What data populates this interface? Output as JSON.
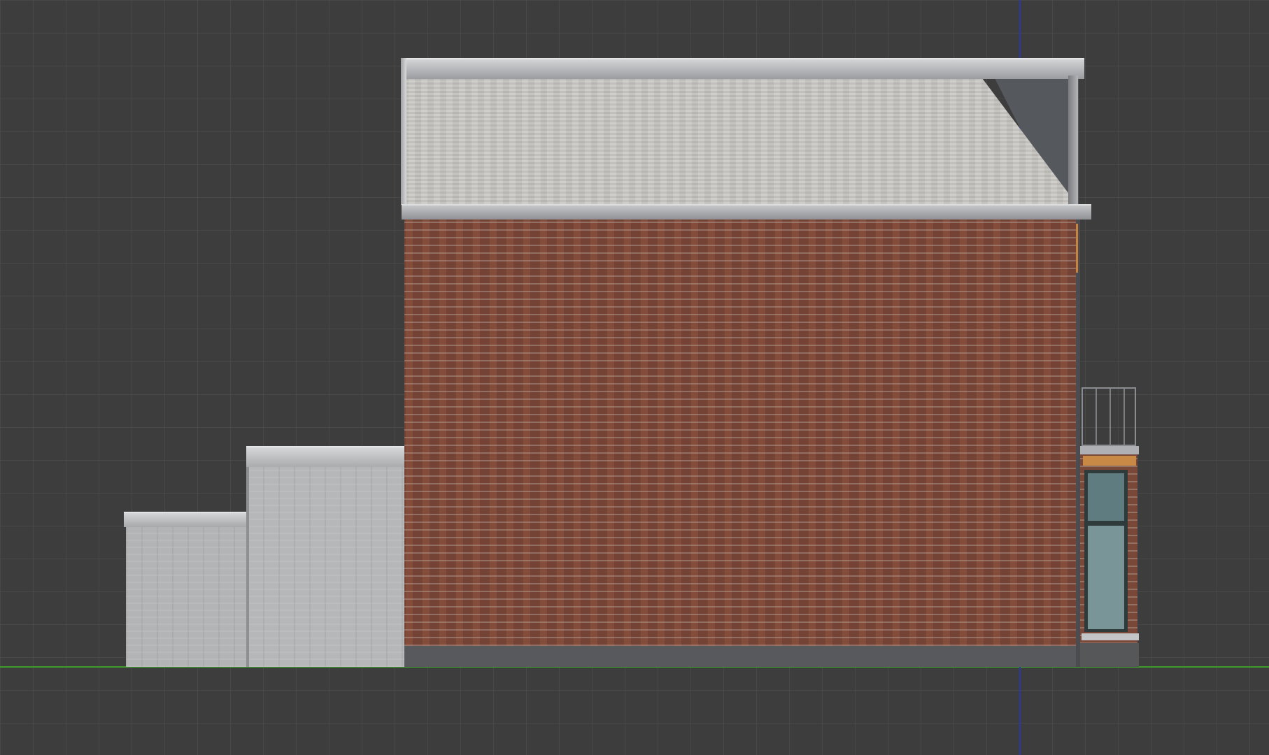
{
  "viewport": {
    "background_color": "#3d3d3d",
    "grid_color": "#505050",
    "x_axis_color": "#3f9c2c",
    "y_axis_color": "#2b38a8"
  },
  "scene": {
    "brick_color": "#7d4a3b",
    "roof_color": "#c9c7c3",
    "extension_color": "#b6b7b8",
    "door_glass_color": "#7a9598"
  }
}
